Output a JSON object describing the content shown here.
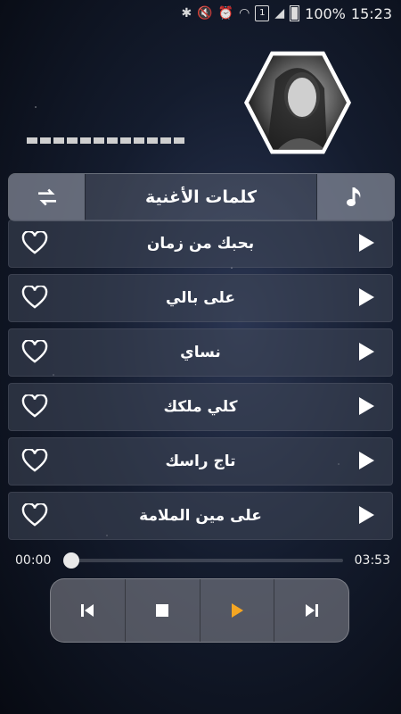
{
  "status": {
    "battery": "100%",
    "time": "15:23",
    "sim": "1"
  },
  "header": {
    "title": "كلمات الأغنية",
    "left_icon": "repeat-icon",
    "right_icon": "music-note-icon"
  },
  "songs": [
    {
      "title": "بحبك من زمان"
    },
    {
      "title": "على بالي"
    },
    {
      "title": "نساي"
    },
    {
      "title": "كلي ملكك"
    },
    {
      "title": "تاج راسك"
    },
    {
      "title": "على مين الملامة"
    }
  ],
  "player": {
    "current_time": "00:00",
    "duration": "03:53",
    "progress": 0,
    "accent": "#f5a623",
    "controls": [
      "previous-icon",
      "stop-icon",
      "play-icon",
      "next-icon"
    ]
  }
}
